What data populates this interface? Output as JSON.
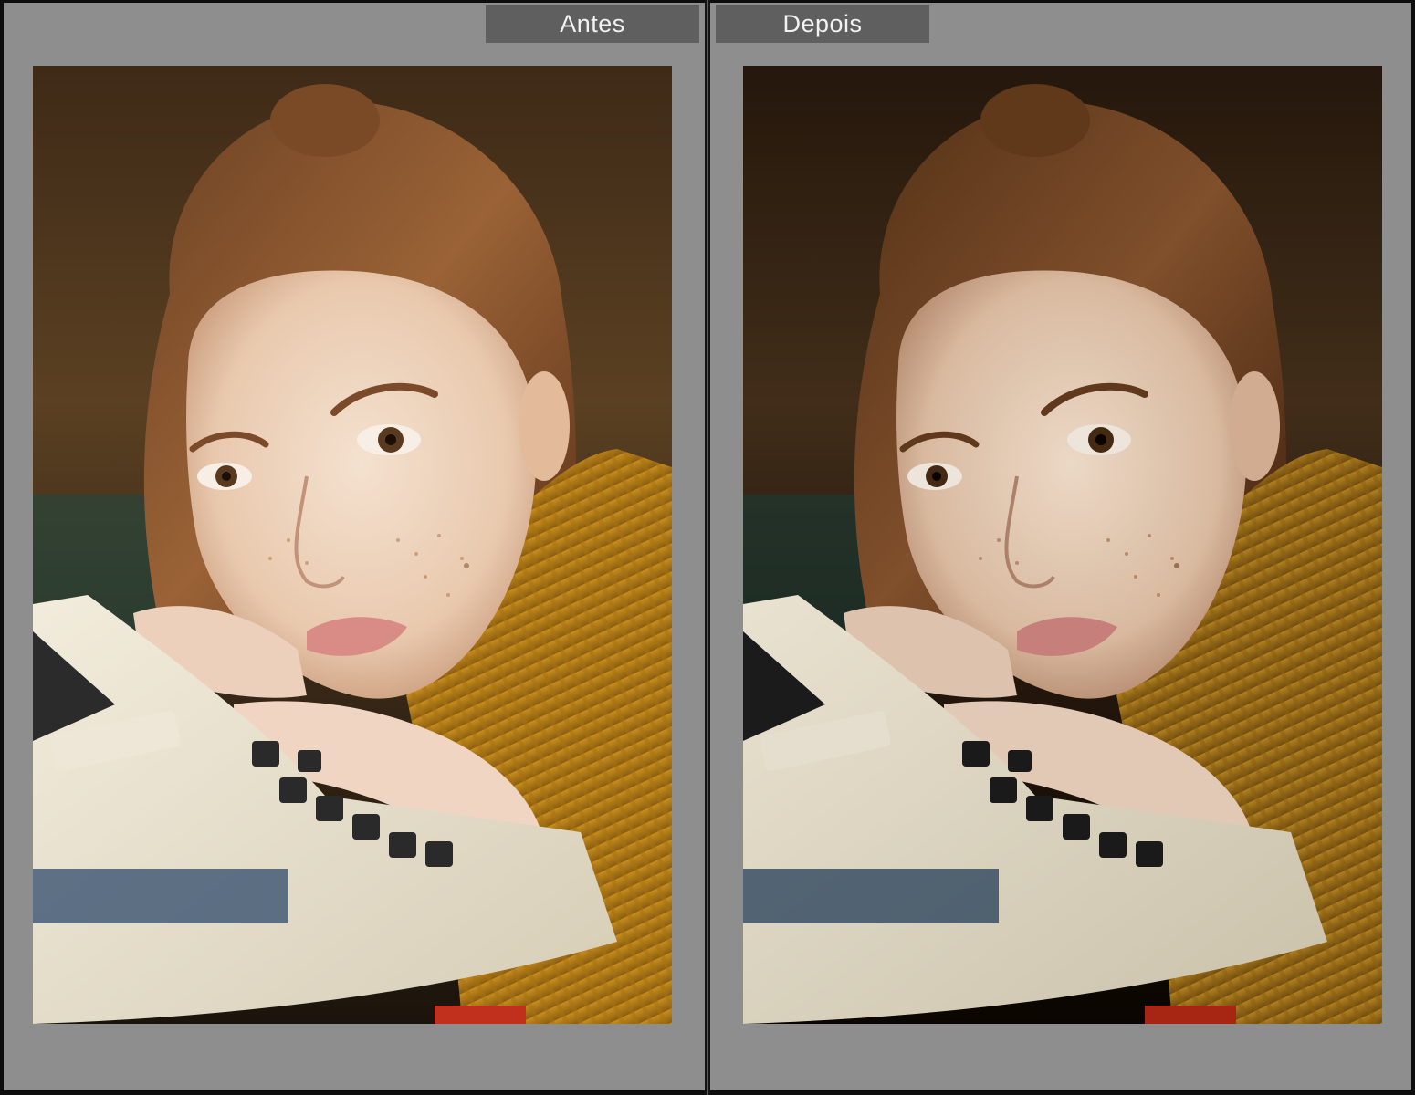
{
  "panels": {
    "before": {
      "label": "Antes"
    },
    "after": {
      "label": "Depois"
    }
  },
  "colors": {
    "pane_background": "#8e8e8e",
    "tab_background": "#5f5f5f",
    "tab_text": "#f2f2f2",
    "divider": "#141414"
  }
}
